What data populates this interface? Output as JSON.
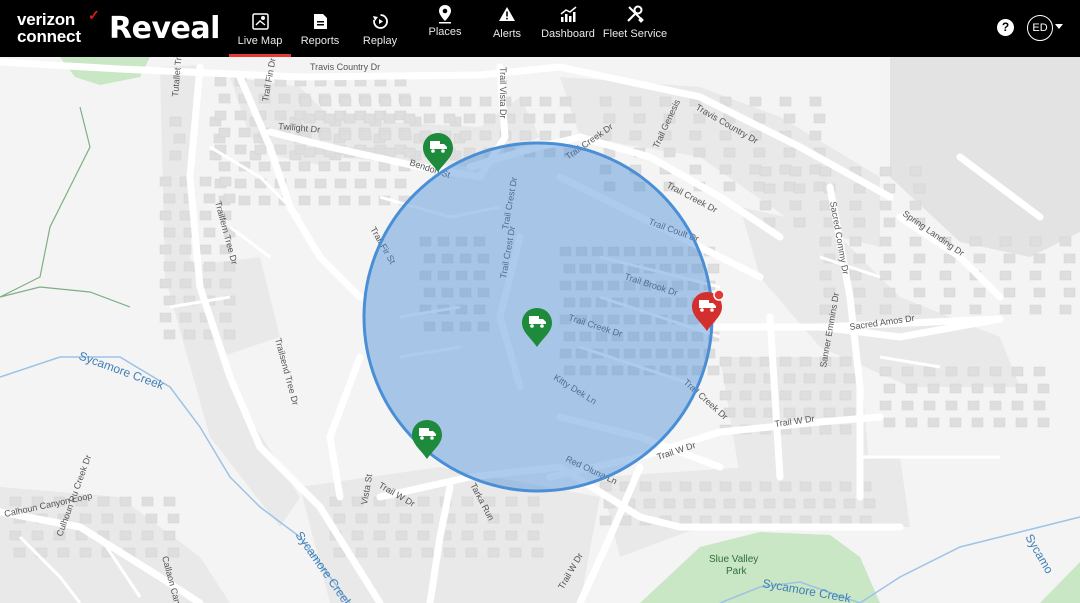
{
  "header": {
    "brand_line1": "verizon",
    "brand_line2": "connect",
    "product": "Reveal",
    "nav": [
      {
        "label": "Live Map",
        "icon": "map-icon",
        "active": true
      },
      {
        "label": "Reports",
        "icon": "report-icon",
        "active": false
      },
      {
        "label": "Replay",
        "icon": "replay-icon",
        "active": false
      },
      {
        "label": "Places",
        "icon": "place-pin-icon",
        "active": false
      },
      {
        "label": "Alerts",
        "icon": "alert-triangle-icon",
        "active": false
      },
      {
        "label": "Dashboard",
        "icon": "chart-icon",
        "active": false
      },
      {
        "label": "Fleet Service",
        "icon": "wrench-icon",
        "active": false
      }
    ],
    "help_symbol": "?",
    "user_initials": "ED"
  },
  "map": {
    "geofence_color": "#4a8fd6",
    "vehicle_ok_color": "#1e8a3c",
    "vehicle_alert_color": "#d32f2f",
    "streets": [
      "Travis Country Dr",
      "Trail Vista Dr",
      "Trail Fin Dr",
      "Tutallet Tree Dr",
      "Twilight Dr",
      "Bendon St",
      "Trail Creek Dr",
      "Trail Crest Dr",
      "Trail Genesis",
      "Travis Country Dr",
      "Trailfern Tree Dr",
      "Trail Crest Dr",
      "Trail Fir St",
      "Trail Coult Dr",
      "Trail Brook Dr",
      "Sacred Commy Dr",
      "Spring Landing Dr",
      "Trailsend Tree Dr",
      "Trail Creek Dr",
      "Sacred Amos Dr",
      "Trail Creek Dr",
      "Kitty Dek Ln",
      "Trail Creek Dr",
      "Sanner Emmins Dr",
      "Trail W Dr",
      "Trail W Dr",
      "Red Oluna Ln",
      "Trail W Dr",
      "Calhoun Canyon Loop",
      "Culhoun Ru Creek Dr",
      "Callaon Canyon",
      "Vista St",
      "Tarka Run",
      "Trail W Dr"
    ],
    "water_labels": [
      "Sycamore Creek",
      "Sycamore Creek",
      "Sycamore Creek",
      "Sycamo"
    ],
    "park_name": "Slue Valley Park"
  }
}
